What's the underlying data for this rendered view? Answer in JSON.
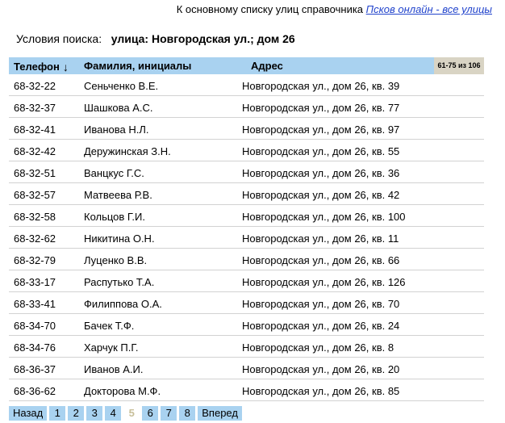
{
  "top": {
    "text": "К основному списку улиц справочника",
    "link_label": "Псков онлайн - все улицы"
  },
  "search": {
    "label": "Условия поиска:",
    "criteria": "улица: Новгородская ул.;  дом 26"
  },
  "table": {
    "headers": {
      "phone": "Телефон",
      "name": "Фамилия, инициалы",
      "address": "Адрес"
    },
    "sort_arrow": "↓",
    "count": "61-75 из 106",
    "rows": [
      {
        "phone": "68-32-22",
        "name": "Сеньченко В.Е.",
        "address": "Новгородская ул., дом 26, кв. 39"
      },
      {
        "phone": "68-32-37",
        "name": "Шашкова А.С.",
        "address": "Новгородская ул., дом 26, кв. 77"
      },
      {
        "phone": "68-32-41",
        "name": "Иванова Н.Л.",
        "address": "Новгородская ул., дом 26, кв. 97"
      },
      {
        "phone": "68-32-42",
        "name": "Деружинская З.Н.",
        "address": "Новгородская ул., дом 26, кв. 55"
      },
      {
        "phone": "68-32-51",
        "name": "Ванцкус Г.С.",
        "address": "Новгородская ул., дом 26, кв. 36"
      },
      {
        "phone": "68-32-57",
        "name": "Матвеева Р.В.",
        "address": "Новгородская ул., дом 26, кв. 42"
      },
      {
        "phone": "68-32-58",
        "name": "Кольцов Г.И.",
        "address": "Новгородская ул., дом 26, кв. 100"
      },
      {
        "phone": "68-32-62",
        "name": "Никитина О.Н.",
        "address": "Новгородская ул., дом 26, кв. 11"
      },
      {
        "phone": "68-32-79",
        "name": "Луценко В.В.",
        "address": "Новгородская ул., дом 26, кв. 66"
      },
      {
        "phone": "68-33-17",
        "name": "Распутько Т.А.",
        "address": "Новгородская ул., дом 26, кв. 126"
      },
      {
        "phone": "68-33-41",
        "name": "Филиппова О.А.",
        "address": "Новгородская ул., дом 26, кв. 70"
      },
      {
        "phone": "68-34-70",
        "name": "Бачек Т.Ф.",
        "address": "Новгородская ул., дом 26, кв. 24"
      },
      {
        "phone": "68-34-76",
        "name": "Харчук П.Г.",
        "address": "Новгородская ул., дом 26, кв. 8"
      },
      {
        "phone": "68-36-37",
        "name": "Иванов А.И.",
        "address": "Новгородская ул., дом 26, кв. 20"
      },
      {
        "phone": "68-36-62",
        "name": "Докторова М.Ф.",
        "address": "Новгородская ул., дом 26, кв. 85"
      }
    ]
  },
  "pager": {
    "prev": "Назад",
    "pages": [
      "1",
      "2",
      "3",
      "4",
      "5",
      "6",
      "7",
      "8"
    ],
    "current": "5",
    "next": "Вперед"
  },
  "colors": {
    "header_bg": "#a9d2f0",
    "count_bg": "#d9d4c4",
    "link": "#2244cc",
    "current_page": "#c8bf9a"
  }
}
